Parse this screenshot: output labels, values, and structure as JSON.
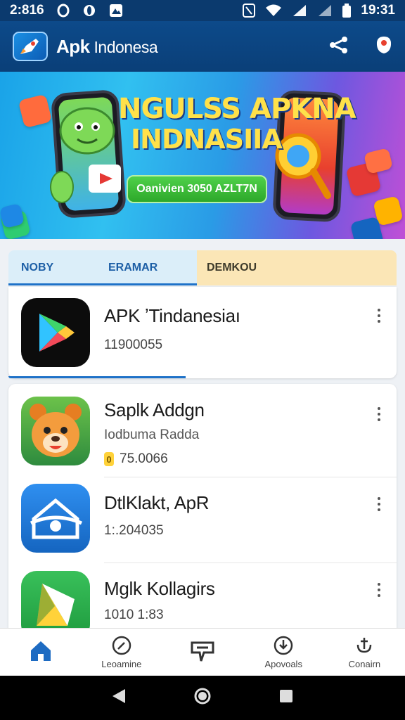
{
  "status_bar": {
    "time_left": "2:816",
    "time_right": "19:31"
  },
  "app_bar": {
    "brand": "Apk",
    "subtitle": " Indonesa"
  },
  "banner": {
    "headline_1": "NGULSS APKNA",
    "headline_2": "INDNASIIA",
    "cta": "Oanivien 3050 AZLT7N"
  },
  "tabs": [
    {
      "label_1": "NOBY",
      "label_2": "ERAMAR"
    },
    {
      "label": "DEMKOU"
    }
  ],
  "featured": {
    "title": "APK ʼTindanesiaı",
    "meta": "11900055"
  },
  "apps": [
    {
      "title": "Saplk Addgn",
      "subtitle": "Iodbuma Radda",
      "badge": "0",
      "meta": "75.0066"
    },
    {
      "title": "DtlKlakt, ApR",
      "meta": "1:.204035"
    },
    {
      "title": "Mglk Kollagirs",
      "meta": "1010 1:83"
    }
  ],
  "bottom_nav": [
    {
      "icon": "home-icon",
      "label": ""
    },
    {
      "icon": "compass-icon",
      "label": "Leoamine"
    },
    {
      "icon": "message-icon",
      "label": ""
    },
    {
      "icon": "download-icon",
      "label": "Apovoals"
    },
    {
      "icon": "anchor-icon",
      "label": "Conairn"
    }
  ],
  "colors": {
    "primary": "#0b3a6e",
    "accent": "#1f72c8",
    "tab_alt": "#fbe6b6"
  }
}
